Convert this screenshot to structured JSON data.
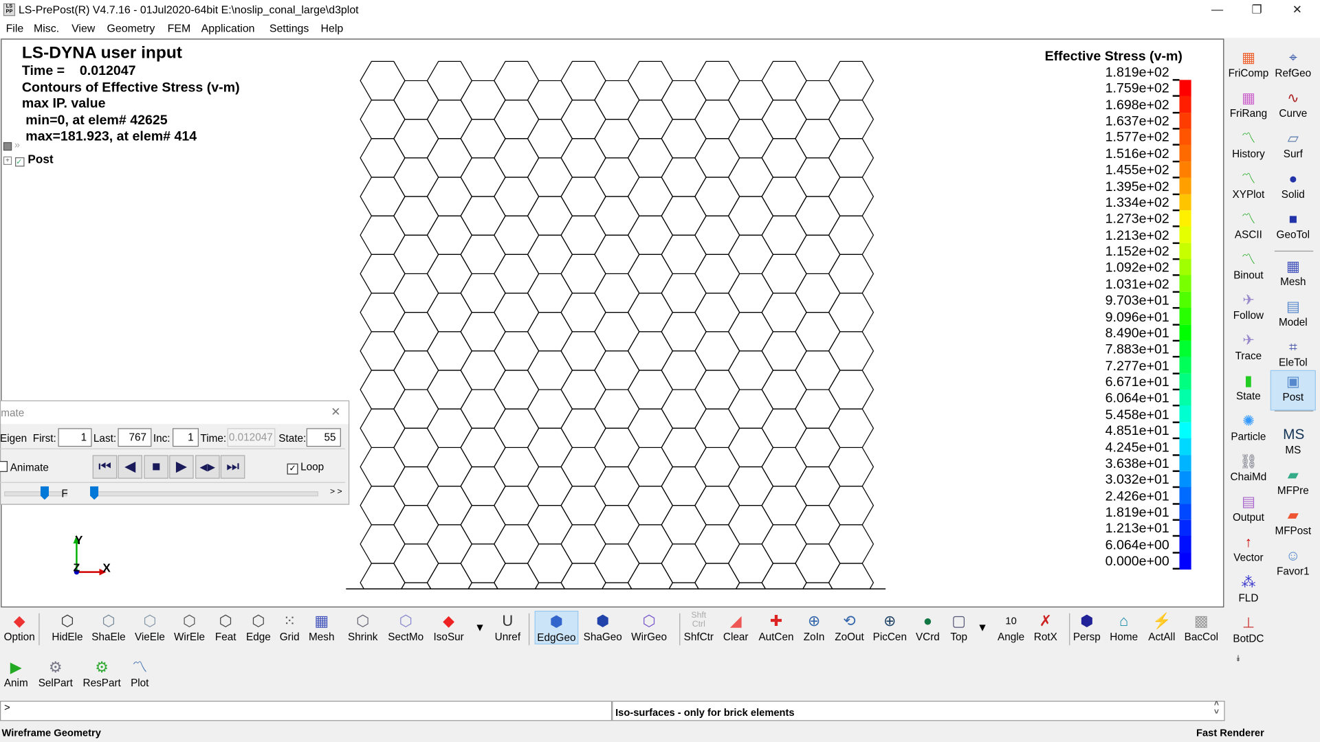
{
  "window": {
    "title": "LS-PrePost(R) V4.7.16 - 01Jul2020-64bit E:\\noslip_conal_large\\d3plot",
    "app_icon": "LS PP",
    "minimize": "—",
    "restore": "❐",
    "close": "✕"
  },
  "menu": [
    "File",
    "Misc.",
    "View",
    "Geometry",
    "FEM",
    "Application",
    "Settings",
    "Help"
  ],
  "viewport": {
    "info": {
      "title": "LS-DYNA user input",
      "time": "Time =    0.012047",
      "contour": "Contours of Effective Stress (v-m)",
      "ip": "max IP. value",
      "min": " min=0, at elem# 42625",
      "max": " max=181.923, at elem# 414"
    },
    "tree": {
      "expand": "»",
      "post": "Post"
    },
    "axes": {
      "x": "X",
      "y": "Y",
      "z": "Z"
    }
  },
  "legend": {
    "title": "Effective Stress (v-m)",
    "labels": [
      "1.819e+02",
      "1.759e+02",
      "1.698e+02",
      "1.637e+02",
      "1.577e+02",
      "1.516e+02",
      "1.455e+02",
      "1.395e+02",
      "1.334e+02",
      "1.273e+02",
      "1.213e+02",
      "1.152e+02",
      "1.092e+02",
      "1.031e+02",
      "9.703e+01",
      "9.096e+01",
      "8.490e+01",
      "7.883e+01",
      "7.277e+01",
      "6.671e+01",
      "6.064e+01",
      "5.458e+01",
      "4.851e+01",
      "4.245e+01",
      "3.638e+01",
      "3.032e+01",
      "2.426e+01",
      "1.819e+01",
      "1.213e+01",
      "6.064e+00",
      "0.000e+00"
    ],
    "colors": [
      "#ff0000",
      "#ff1e00",
      "#ff3c00",
      "#ff5500",
      "#ff6a00",
      "#ff8000",
      "#ffa000",
      "#ffc400",
      "#fff000",
      "#e6ff00",
      "#c8ff00",
      "#a0ff00",
      "#78ff00",
      "#50ff00",
      "#28ff00",
      "#00ff00",
      "#00ff30",
      "#00ff58",
      "#00ff80",
      "#00ffa8",
      "#00ffd0",
      "#00ffff",
      "#00d8ff",
      "#00b4ff",
      "#0090ff",
      "#006cff",
      "#0048ff",
      "#0028ff",
      "#0010ff",
      "#0000ff"
    ]
  },
  "animate": {
    "title": "mate",
    "close": "✕",
    "eigen": "Eigen",
    "first_label": "First:",
    "first": "1",
    "last_label": "Last:",
    "last": "767",
    "inc_label": "Inc:",
    "inc": "1",
    "time_label": "Time:",
    "time": "0.012047",
    "state_label": "State:",
    "state": "55",
    "animate_label": "Animate",
    "animate_checked": false,
    "loop_label": "Loop",
    "loop_checked": true,
    "f_label": "F",
    "more": "> >",
    "buttons": [
      "⏮",
      "◀",
      "■",
      "▶",
      "◀▶",
      "⏭"
    ]
  },
  "right_panel": {
    "left": [
      "FriComp",
      "FriRang",
      "History",
      "XYPlot",
      "ASCII",
      "Binout",
      "Follow",
      "Trace",
      "State",
      "Particle",
      "ChaiMd",
      "Output",
      "Vector",
      "FLD",
      "BotDC"
    ],
    "right": [
      "RefGeo",
      "Curve",
      "Surf",
      "Solid",
      "GeoTol",
      "Mesh",
      "Model",
      "EleTol",
      "Post",
      "MS",
      "MFPre",
      "MFPost",
      "Favor1"
    ],
    "selected": "Post",
    "more": "⯯"
  },
  "toolbar": {
    "row1": [
      "Option",
      "HidEle",
      "ShaEle",
      "VieEle",
      "WirEle",
      "Feat",
      "Edge",
      "Grid",
      "Mesh",
      "Shrink",
      "SectMo",
      "IsoSur",
      "",
      "Unref",
      "EdgGeo",
      "ShaGeo",
      "WirGeo",
      "ShfCtr",
      "Clear",
      "AutCen",
      "ZoIn",
      "ZoOut",
      "PicCen",
      "VCrd",
      "Top",
      "",
      "Angle",
      "RotX",
      "Persp",
      "Home",
      "ActAll",
      "BacCol"
    ],
    "row2": [
      "Anim",
      "SelPart",
      "ResPart",
      "Plot"
    ],
    "selected": "EdgGeo",
    "angle_value": "10",
    "shfctr_icon": "Shft Ctrl",
    "dropdown": "▼"
  },
  "command": {
    "prompt": ">",
    "message": "Iso-surfaces - only for brick elements"
  },
  "status": {
    "left": "Wireframe Geometry",
    "right": "Fast Renderer"
  }
}
